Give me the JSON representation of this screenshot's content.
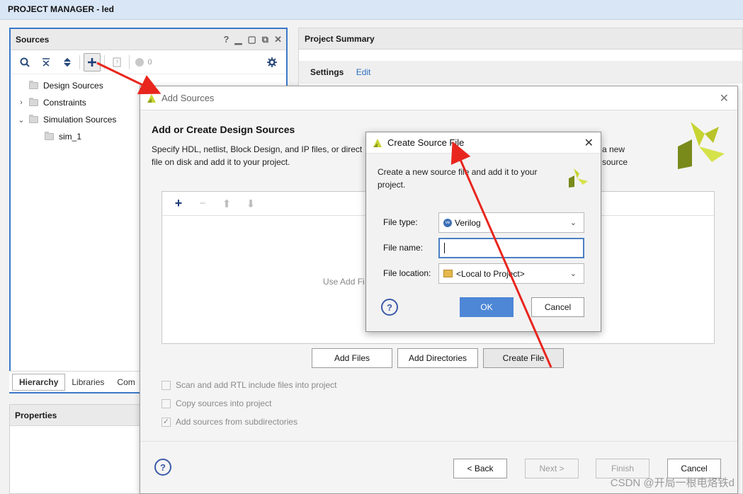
{
  "topbar": {
    "title": "PROJECT MANAGER - led"
  },
  "sources": {
    "title": "Sources",
    "badge_count": "0",
    "tree": [
      {
        "label": "Design Sources",
        "caret": ""
      },
      {
        "label": "Constraints",
        "caret": "›"
      },
      {
        "label": "Simulation Sources",
        "caret": "⌄"
      },
      {
        "label": "sim_1",
        "caret": ""
      }
    ],
    "tabs": [
      "Hierarchy",
      "Libraries",
      "Com"
    ]
  },
  "properties": {
    "title": "Properties"
  },
  "summary": {
    "title": "Project Summary",
    "settings_label": "Settings",
    "edit_link": "Edit"
  },
  "add_sources": {
    "title": "Add Sources",
    "heading": "Add or Create Design Sources",
    "description_left": "Specify HDL, netlist, Block Design, and IP files, or direct",
    "description_right": "a new source",
    "description_line2": "file on disk and add it to your project.",
    "hint": "Use Add Fi",
    "buttons": {
      "add_files": "Add Files",
      "add_directories": "Add Directories",
      "create_file": "Create File"
    },
    "checkboxes": [
      {
        "label": "Scan and add RTL include files into project",
        "checked": false
      },
      {
        "label": "Copy sources into project",
        "checked": false
      },
      {
        "label": "Add sources from subdirectories",
        "checked": true
      }
    ],
    "footer": {
      "back": "< Back",
      "next": "Next >",
      "finish": "Finish",
      "cancel": "Cancel"
    }
  },
  "create_source_file": {
    "title": "Create Source File",
    "description": "Create a new source file and add it to your project.",
    "file_type_label": "File type:",
    "file_type_value": "Verilog",
    "file_name_label": "File name:",
    "file_name_value": "",
    "file_location_label": "File location:",
    "file_location_value": "<Local to Project>",
    "ok": "OK",
    "cancel": "Cancel"
  },
  "watermark": "CSDN @开局一根电烙铁d",
  "colors": {
    "accent_blue": "#3b78c9",
    "ok_blue": "#4d87d6",
    "arrow_red": "#e8261e",
    "logo_green": "#c8d432"
  }
}
